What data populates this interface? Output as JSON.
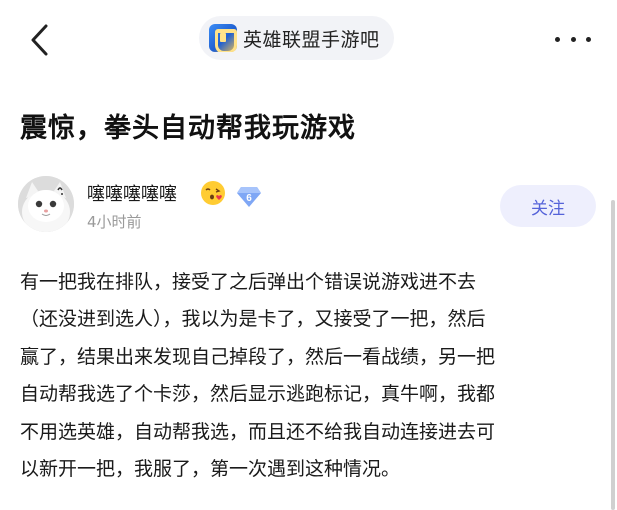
{
  "forum": {
    "name": "英雄联盟手游吧",
    "logo_icon": "league-of-legends-wild-rift-logo"
  },
  "icons": {
    "back": "chevron-left-icon",
    "more": "more-horizontal-icon",
    "emoji": "blowing-kiss-emoji",
    "level": "diamond-badge-icon"
  },
  "post": {
    "title": "震惊，拳头自动帮我玩游戏",
    "author": {
      "name": "噻噻噻噻噻",
      "level": "6",
      "time": "4小时前"
    },
    "follow_label": "关注",
    "body_lines": [
      "有一把我在排队，接受了之后弹出个错误说游戏进不去",
      "（还没进到选人），我以为是卡了，又接受了一把，然后",
      "赢了，结果出来发现自己掉段了，然后一看战绩，另一把",
      "自动帮我选了个卡莎，然后显示逃跑标记，真牛啊，我都",
      "不用选英雄，自动帮我选，而且还不给我自动连接进去可",
      "以新开一把，我服了，第一次遇到这种情况。"
    ]
  },
  "colors": {
    "follow_bg": "#eeeffd",
    "follow_text": "#5563d9",
    "level_badge": "#7fa7f5",
    "muted_text": "#9a9a9a"
  }
}
